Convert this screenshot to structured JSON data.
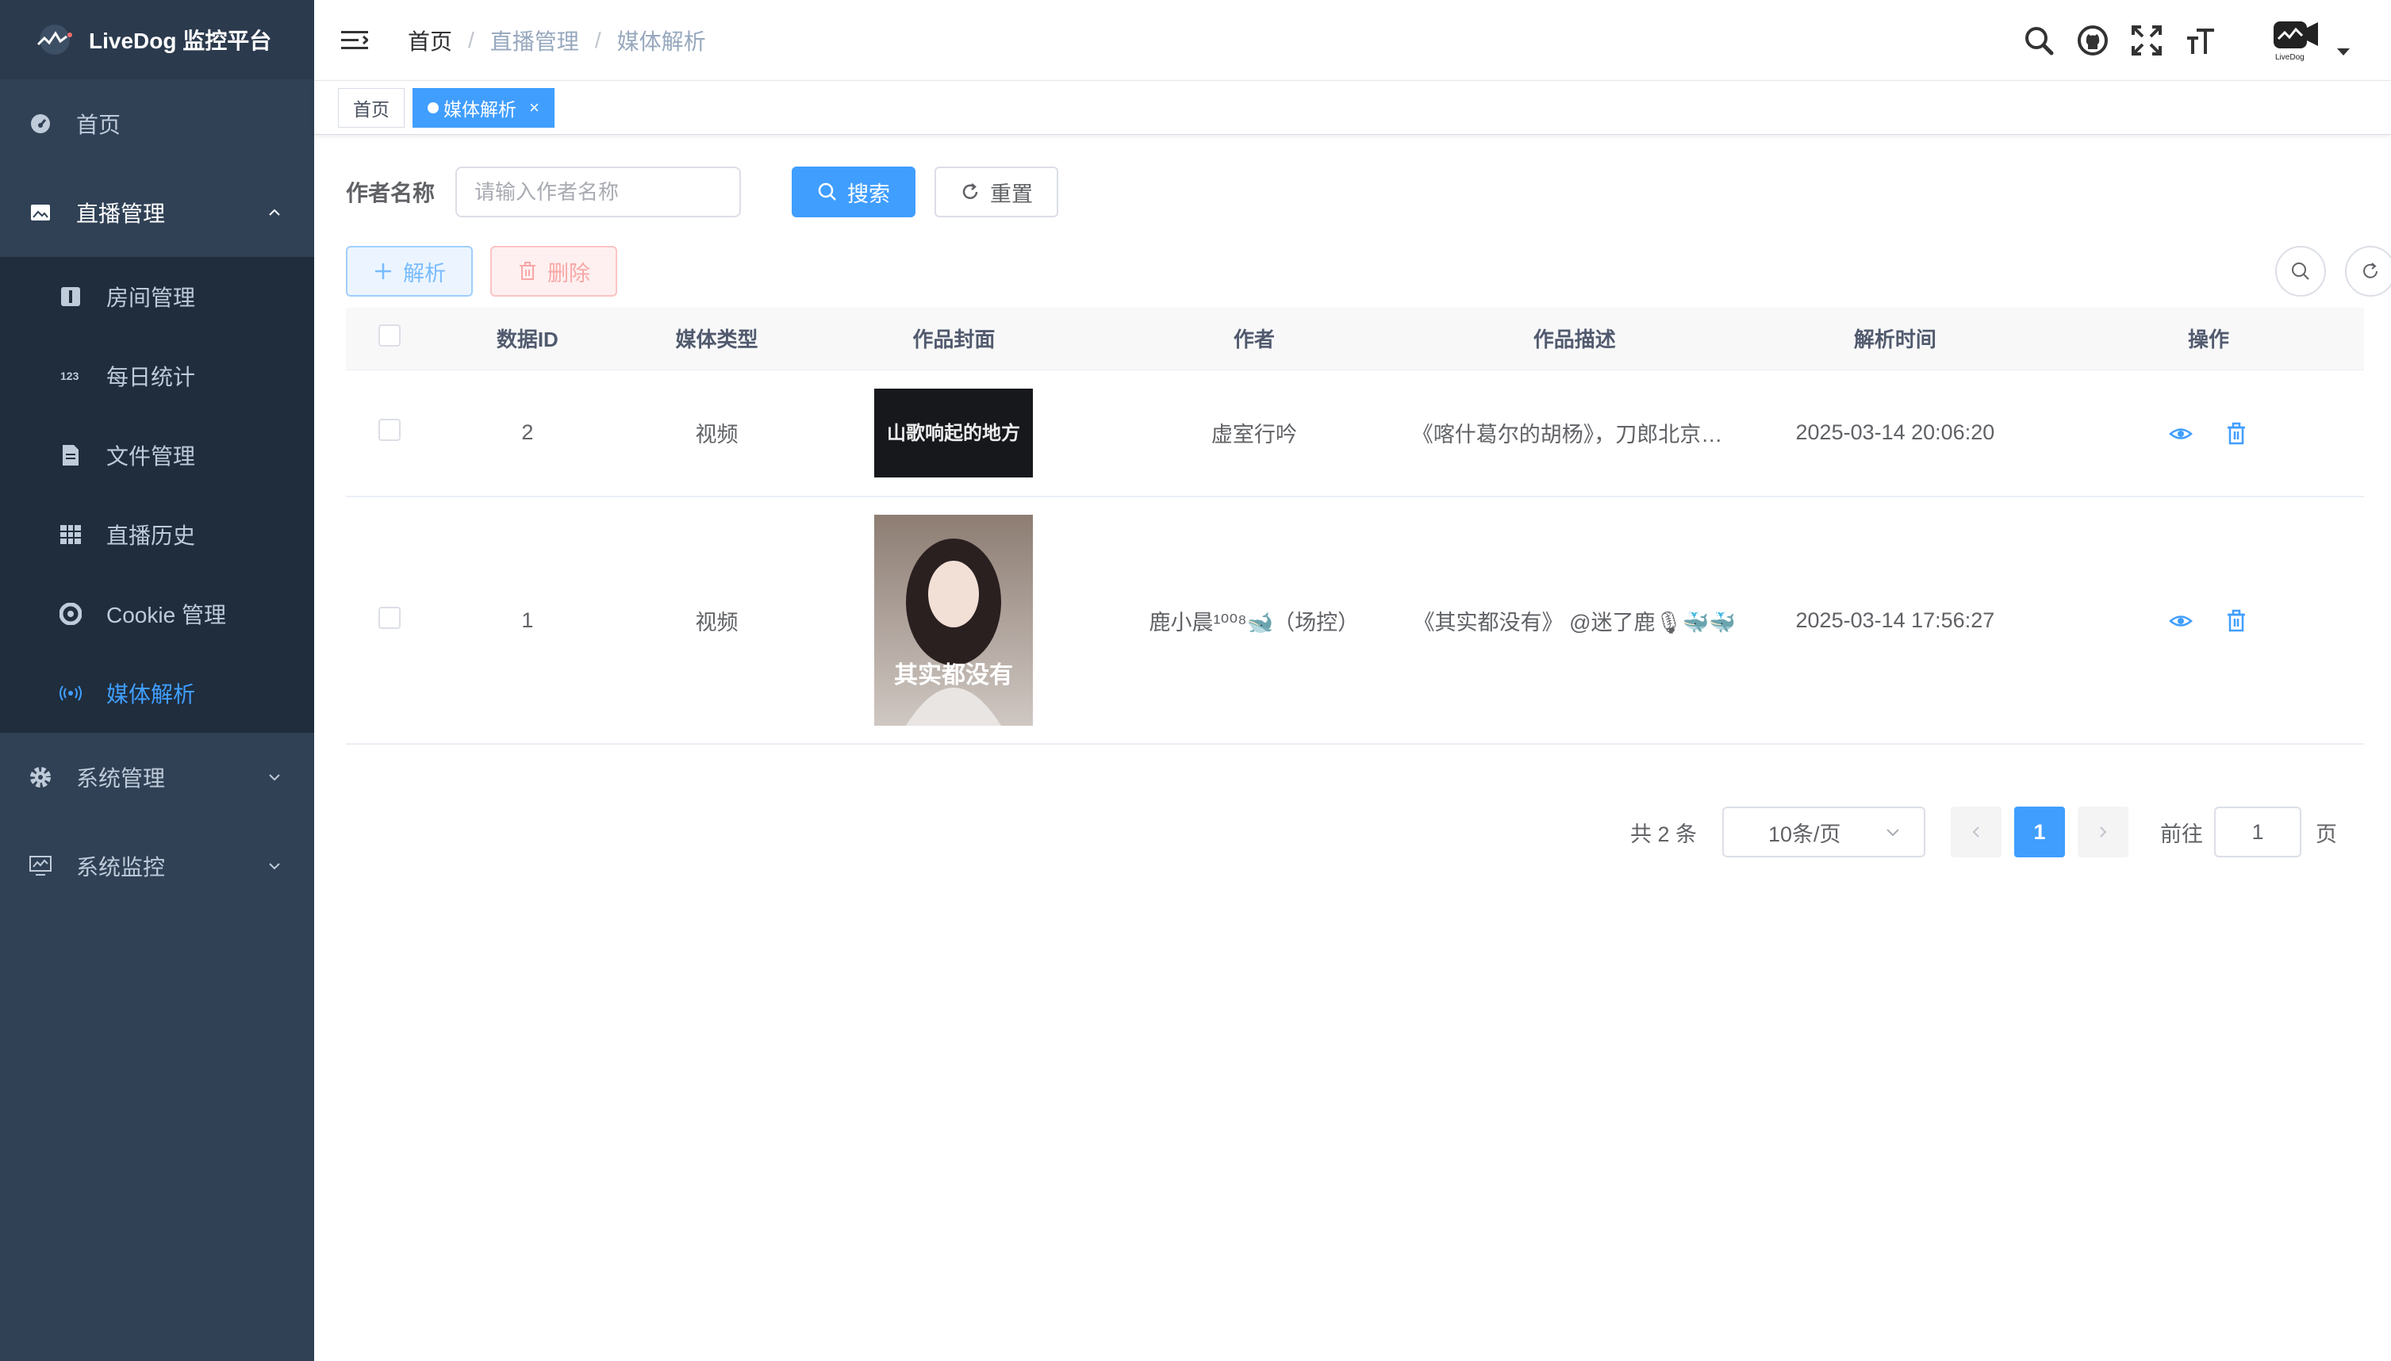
{
  "app": {
    "title": "LiveDog 监控平台"
  },
  "sidebar": {
    "items": [
      {
        "label": "首页",
        "icon": "dashboard-icon"
      },
      {
        "label": "直播管理",
        "icon": "image-icon"
      },
      {
        "label": "系统管理",
        "icon": "gear-icon"
      },
      {
        "label": "系统监控",
        "icon": "monitor-icon"
      }
    ],
    "submenu": [
      {
        "label": "房间管理",
        "icon": "info-icon"
      },
      {
        "label": "每日统计",
        "icon": "number-icon"
      },
      {
        "label": "文件管理",
        "icon": "document-icon"
      },
      {
        "label": "直播历史",
        "icon": "table-icon"
      },
      {
        "label": "Cookie 管理",
        "icon": "cookie-icon"
      },
      {
        "label": "媒体解析",
        "icon": "broadcast-icon"
      }
    ]
  },
  "header": {
    "breadcrumb": [
      "首页",
      "直播管理",
      "媒体解析"
    ],
    "breadcrumb_sep": "/",
    "avatar_text": "LiveDog"
  },
  "tags": {
    "home": "首页",
    "active": "媒体解析",
    "close": "×"
  },
  "search": {
    "label": "作者名称",
    "placeholder": "请输入作者名称",
    "search_btn": "搜索",
    "reset_btn": "重置"
  },
  "toolbar": {
    "parse_btn": "解析",
    "delete_btn": "删除"
  },
  "table": {
    "headers": [
      "数据ID",
      "媒体类型",
      "作品封面",
      "作者",
      "作品描述",
      "解析时间",
      "操作"
    ],
    "rows": [
      {
        "id": "2",
        "type": "视频",
        "author": "虚室行吟",
        "desc": "《喀什葛尔的胡杨》，刀郎北京演唱会",
        "time": "2025-03-14 20:06:20",
        "cover_text": "山歌响起的地方"
      },
      {
        "id": "1",
        "type": "视频",
        "author": "鹿小晨¹⁰⁰⁸🐋（场控）",
        "desc": "《其实都没有》 @迷了鹿🎙🐳🐳",
        "time": "2025-03-14 17:56:27",
        "cover_text": "其实都没有"
      }
    ]
  },
  "pagination": {
    "total": "共 2 条",
    "page_size": "10条/页",
    "current": "1",
    "goto_label": "前往",
    "goto_value": "1",
    "page_suffix": "页"
  },
  "colors": {
    "primary": "#409eff",
    "sidebar_bg": "#304156",
    "submenu_bg": "#1f2d3d",
    "active_text": "#409eff"
  }
}
